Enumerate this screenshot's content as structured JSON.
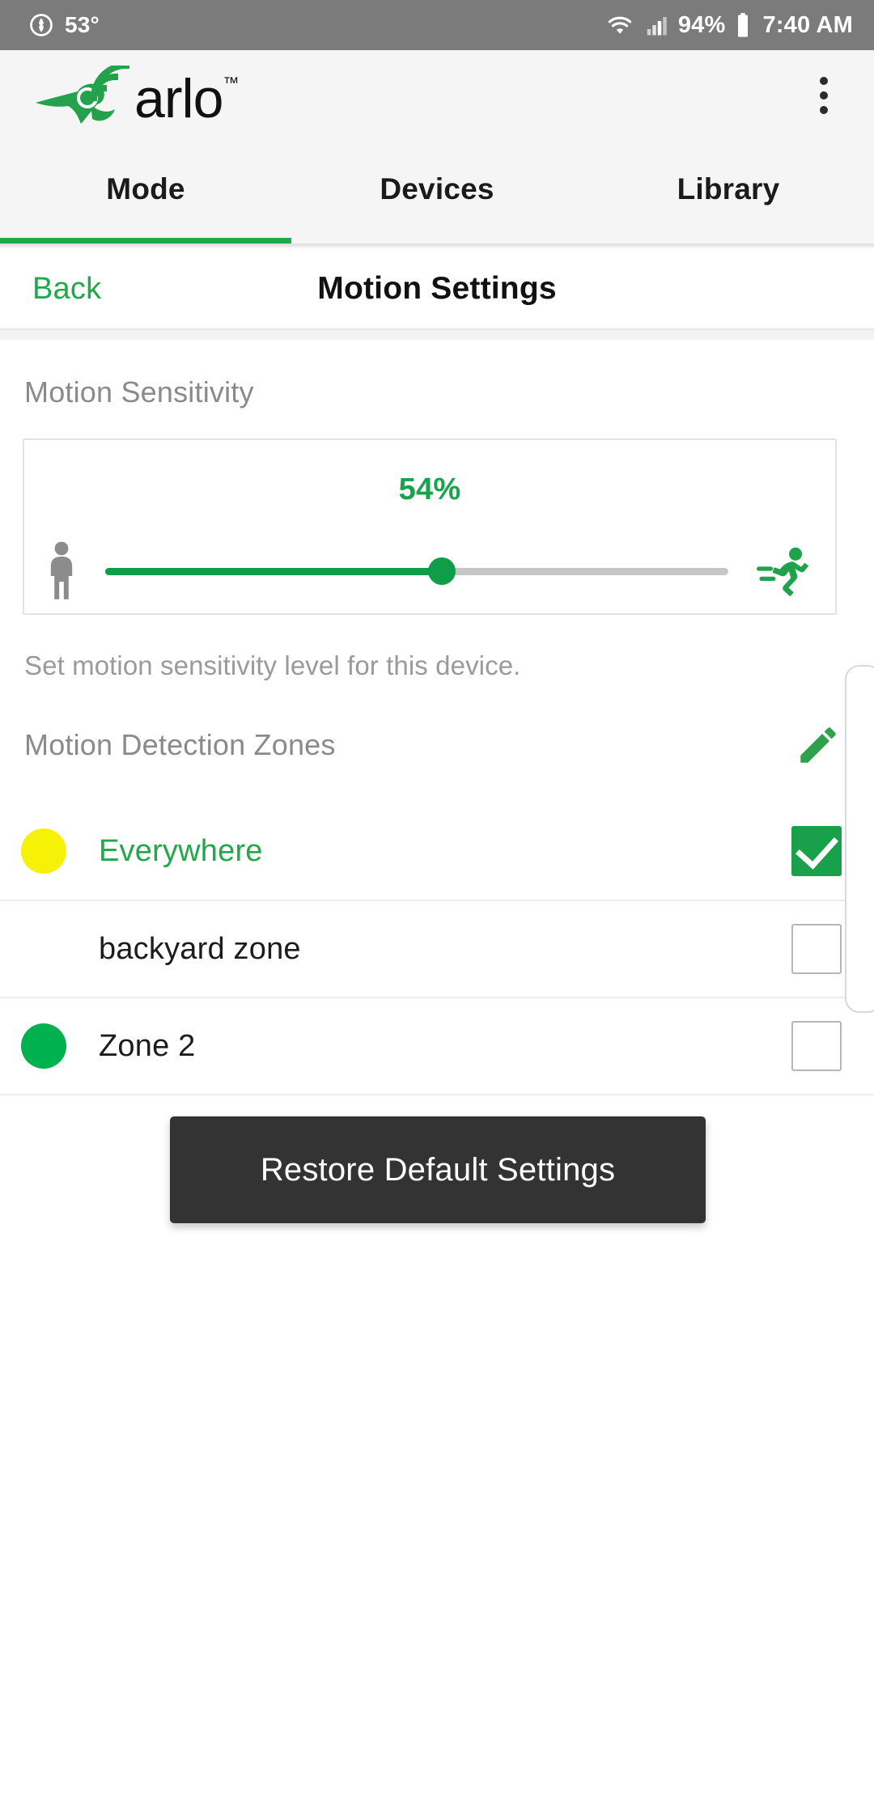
{
  "statusbar": {
    "weather_icon": "weather-droplet-icon",
    "temperature": "53°",
    "wifi_icon": "wifi-icon",
    "signal_icon": "cellular-signal-icon",
    "battery_percent": "94%",
    "battery_icon": "battery-icon",
    "time": "7:40 AM",
    "bg_color": "#7b7b7b"
  },
  "appbar": {
    "logo_text": "arlo",
    "logo_trademark": "™",
    "logo_icon": "arlo-bird-wifi-logo",
    "overflow_menu_icon": "overflow-menu-icon",
    "brand_green": "#1ea34a"
  },
  "tabs": {
    "items": [
      {
        "label": "Mode",
        "active": true
      },
      {
        "label": "Devices",
        "active": false
      },
      {
        "label": "Library",
        "active": false
      }
    ],
    "active_indicator_color": "#20a84a"
  },
  "subheader": {
    "back_label": "Back",
    "title": "Motion Settings"
  },
  "motion_sensitivity": {
    "section_label": "Motion Sensitivity",
    "value_label": "54%",
    "value_percent": 54,
    "low_icon": "standing-person-icon",
    "high_icon": "running-person-icon",
    "helper_text": "Set motion sensitivity level for this device.",
    "fill_color": "#0f9d49",
    "track_color": "#c6c6c6"
  },
  "motion_zones": {
    "section_label": "Motion Detection Zones",
    "edit_icon": "edit-pencil-icon",
    "rows": [
      {
        "name": "Everywhere",
        "dot_color": "#f7f007",
        "has_dot": true,
        "checked": true,
        "selected": true
      },
      {
        "name": "backyard zone",
        "dot_color": "",
        "has_dot": false,
        "checked": false,
        "selected": false
      },
      {
        "name": "Zone 2",
        "dot_color": "#00b14f",
        "has_dot": true,
        "checked": false,
        "selected": false
      }
    ]
  },
  "snackbar": {
    "label": "Restore Default Settings",
    "bg_color": "#333333"
  }
}
